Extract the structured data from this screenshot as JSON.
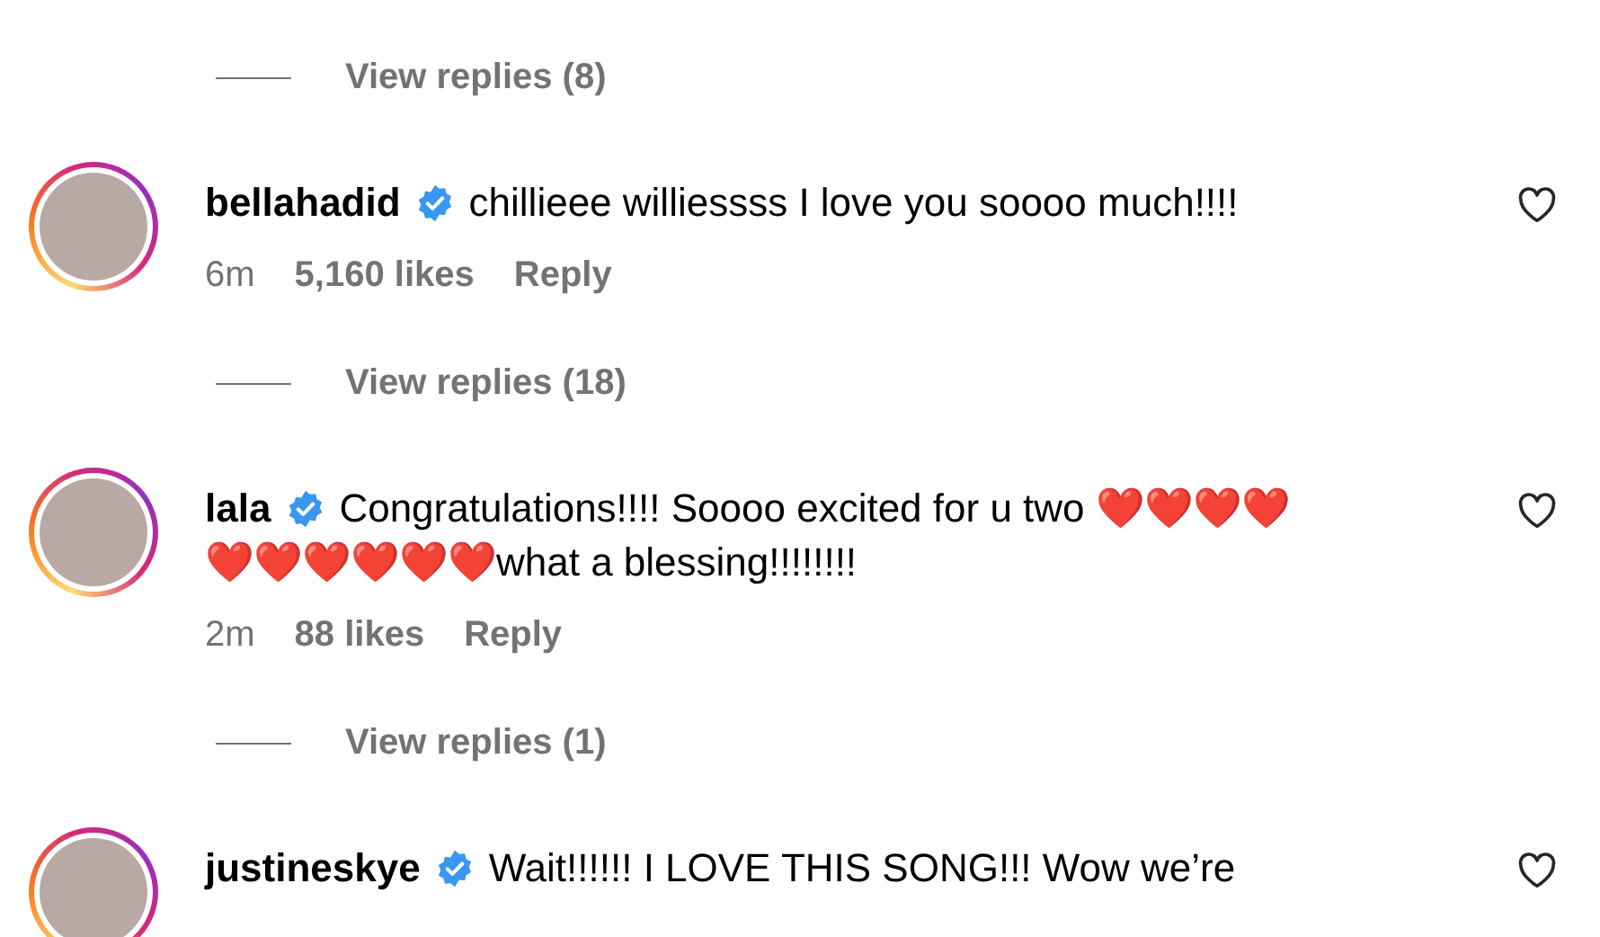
{
  "items": [
    {
      "kind": "view_replies",
      "label": "View replies (8)"
    },
    {
      "kind": "comment",
      "username": "bellahadid",
      "verified": true,
      "lines": [
        "chillieee williessss I love you soooo much!!!!"
      ],
      "time": "6m",
      "likes": "5,160 likes",
      "reply": "Reply",
      "liked": false
    },
    {
      "kind": "view_replies",
      "label": "View replies (18)"
    },
    {
      "kind": "comment",
      "username": "lala",
      "verified": true,
      "lines": [
        "Congratulations!!!! Soooo excited for u two ❤️❤️❤️❤️",
        "❤️❤️❤️❤️❤️❤️what a blessing!!!!!!!!"
      ],
      "time": "2m",
      "likes": "88 likes",
      "reply": "Reply",
      "liked": false
    },
    {
      "kind": "view_replies",
      "label": "View replies (1)"
    },
    {
      "kind": "comment",
      "username": "justineskye",
      "verified": true,
      "lines": [
        "Wait!!!!!! I LOVE THIS SONG!!! Wow we’re"
      ],
      "liked": false
    }
  ]
}
